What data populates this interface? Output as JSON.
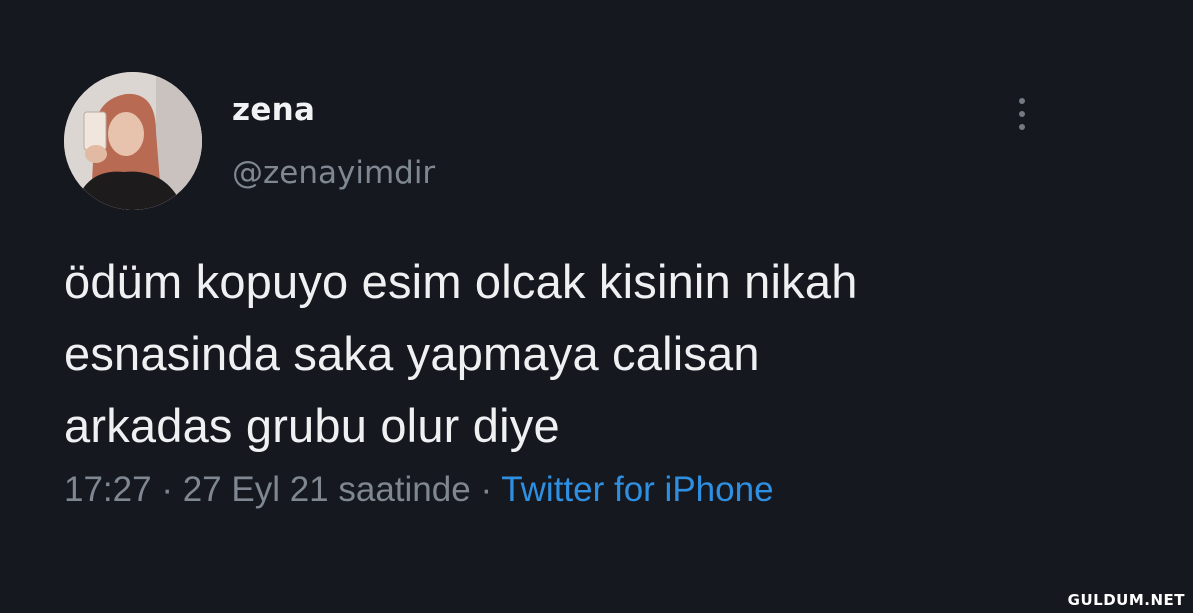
{
  "tweet": {
    "author": {
      "display_name": "zena",
      "handle": "@zenayimdir",
      "avatar": "profile-photo"
    },
    "text_lines": [
      "ödüm kopuyo esim olcak kisinin nikah",
      "esnasinda saka yapmaya calisan",
      "arkadas grubu olur diye"
    ],
    "time": "17:27",
    "separator": "·",
    "date": "27 Eyl 21 saatinde",
    "source": "Twitter for iPhone",
    "more_icon": "vertical-ellipsis-icon"
  },
  "watermark": "GULDUM.NET",
  "colors": {
    "background": "#15181f",
    "text": "#eef0f2",
    "muted": "#7f8790",
    "link": "#2f8fe0"
  }
}
